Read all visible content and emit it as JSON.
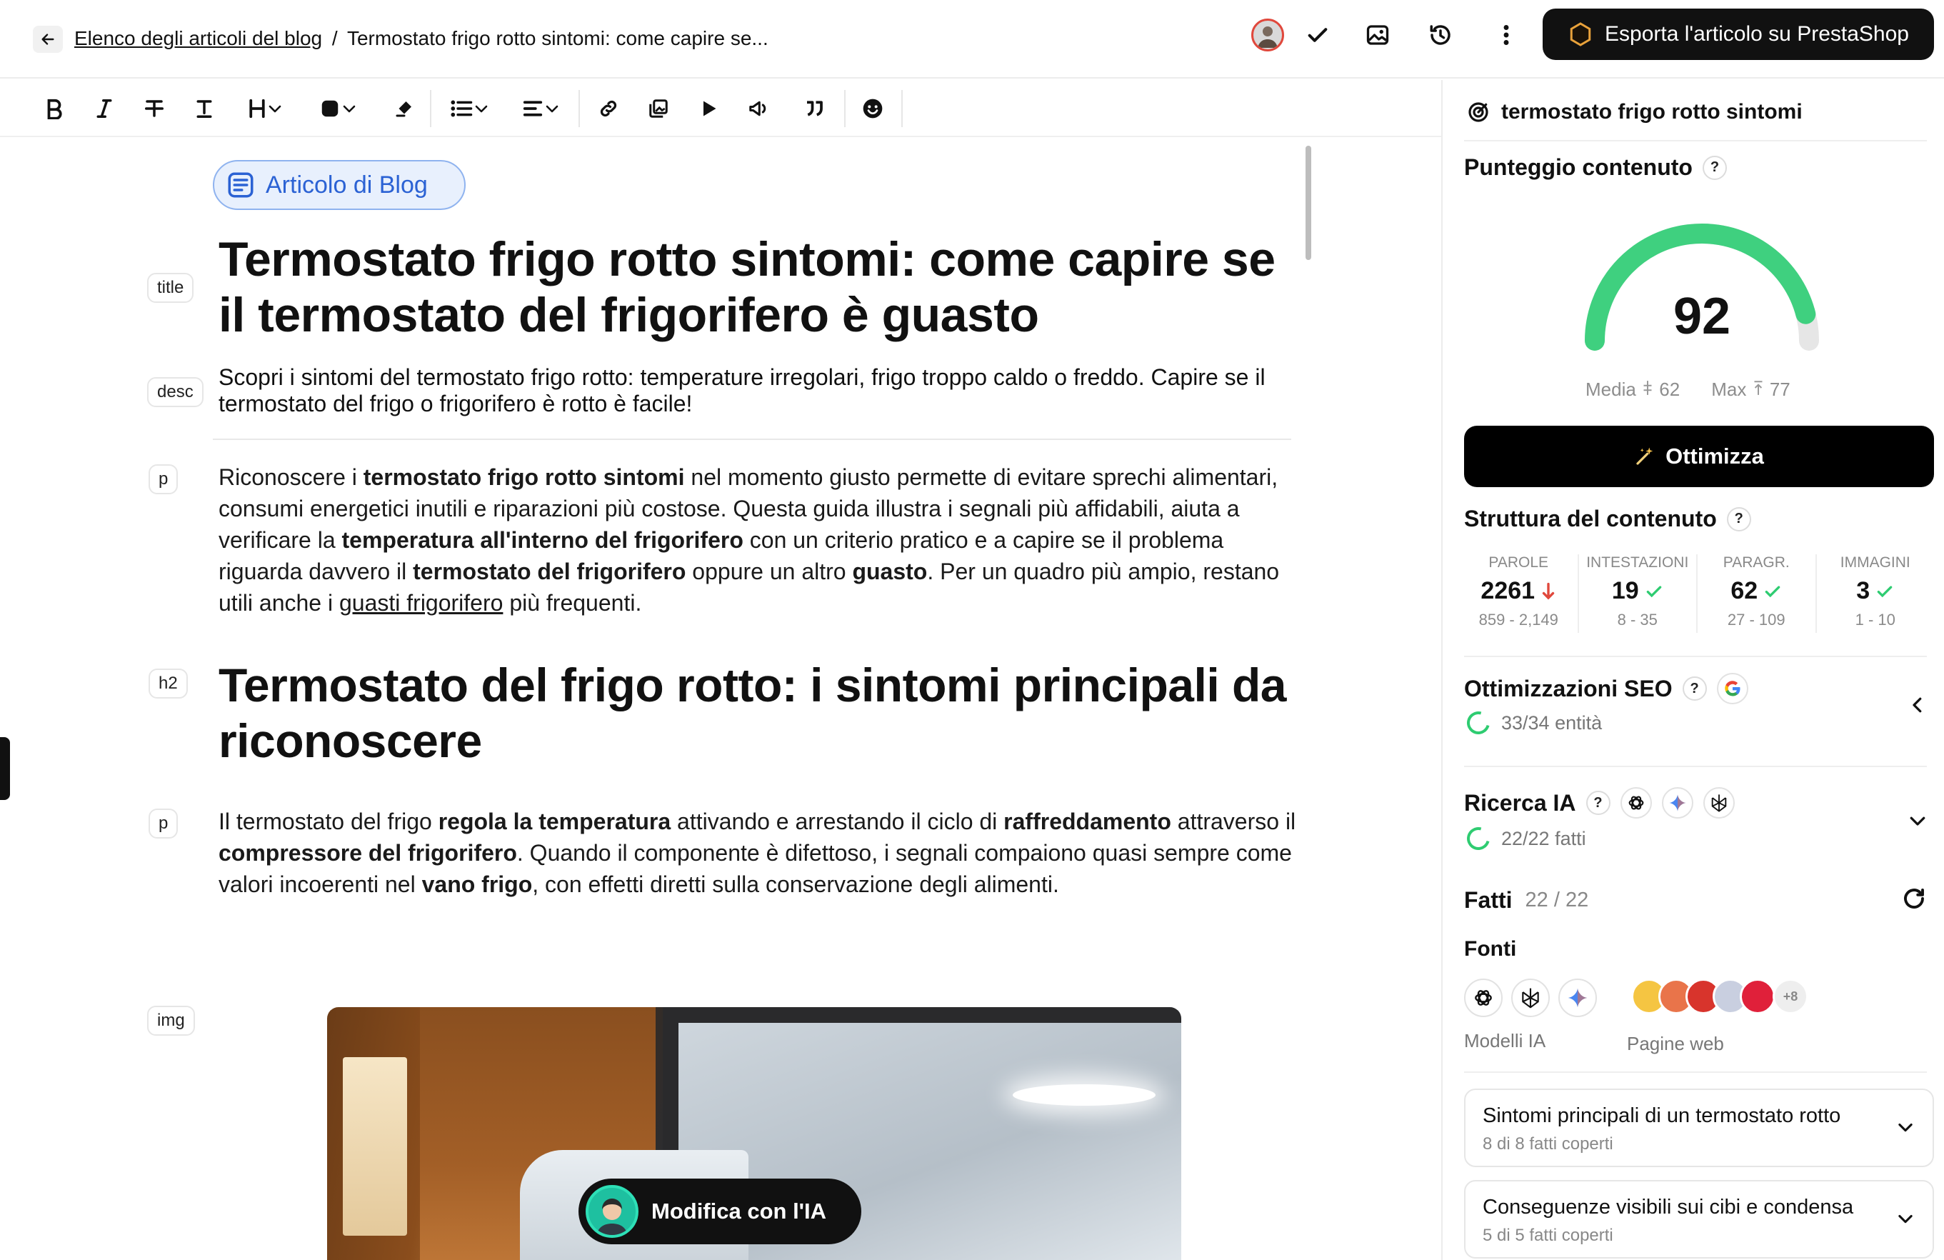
{
  "header": {
    "breadcrumb_link": "Elenco degli articoli del blog",
    "breadcrumb_sep": "/",
    "breadcrumb_current": "Termostato frigo rotto sintomi: come capire se...",
    "export_label": "Esporta l'articolo su PrestaShop"
  },
  "editor": {
    "type_chip": "Articolo di Blog",
    "labels": {
      "title": "title",
      "desc": "desc",
      "p": "p",
      "h2": "h2",
      "img": "img"
    },
    "title": "Termostato frigo rotto sintomi: come capire se il termostato del frigorifero è guasto",
    "description": "Scopri i sintomi del termostato frigo rotto: temperature irregolari, frigo troppo caldo o freddo. Capire se il termostato del frigo o frigorifero è rotto è facile!",
    "para1": [
      {
        "t": "Riconoscere i "
      },
      {
        "t": "termostato frigo rotto sintomi",
        "b": true
      },
      {
        "t": " nel momento giusto permette di evitare sprechi alimentari, consumi energetici inutili e riparazioni più costose. Questa guida illustra i segnali più affidabili, aiuta a verificare la "
      },
      {
        "t": "temperatura all'interno del frigorifero",
        "b": true
      },
      {
        "t": " con un criterio pratico e a capire se il problema riguarda davvero il "
      },
      {
        "t": "termostato del frigorifero",
        "b": true
      },
      {
        "t": " oppure un altro "
      },
      {
        "t": "guasto",
        "b": true
      },
      {
        "t": ". Per un quadro più ampio, restano utili anche i "
      },
      {
        "t": "guasti frigorifero",
        "u": true
      },
      {
        "t": " più frequenti."
      }
    ],
    "h2": "Termostato del frigo rotto: i sintomi principali da riconoscere",
    "para2": [
      {
        "t": "Il termostato del frigo "
      },
      {
        "t": "regola la temperatura",
        "b": true
      },
      {
        "t": " attivando e arrestando il ciclo di "
      },
      {
        "t": "raffreddamento",
        "b": true
      },
      {
        "t": " attraverso il "
      },
      {
        "t": "compressore del frigorifero",
        "b": true
      },
      {
        "t": ". Quando il componente è difettoso, i segnali compaiono quasi sempre come valori incoerenti nel "
      },
      {
        "t": "vano frigo",
        "b": true
      },
      {
        "t": ", con effetti diretti sulla conservazione degli alimenti."
      }
    ],
    "ai_edit_label": "Modifica con l'IA"
  },
  "panel": {
    "keyword": "termostato frigo rotto sintomi",
    "content_score_title": "Punteggio contenuto",
    "score": "92",
    "score_fraction": 0.92,
    "avg_label": "Media",
    "avg_value": "62",
    "max_label": "Max",
    "max_value": "77",
    "optimize_label": "Ottimizza",
    "structure_title": "Struttura del contenuto",
    "stats": [
      {
        "label": "PAROLE",
        "value": "2261",
        "status": "down",
        "range": "859 - 2,149"
      },
      {
        "label": "INTESTAZIONI",
        "value": "19",
        "status": "ok",
        "range": "8 - 35"
      },
      {
        "label": "PARAGR.",
        "value": "62",
        "status": "ok",
        "range": "27 - 109"
      },
      {
        "label": "IMMAGINI",
        "value": "3",
        "status": "ok",
        "range": "1 - 10"
      }
    ],
    "seo_title": "Ottimizzazioni SEO",
    "seo_sub": "33/34 entità",
    "ai_title": "Ricerca IA",
    "ai_sub": "22/22 fatti",
    "facts_title": "Fatti",
    "facts_count": "22 / 22",
    "sources_title": "Fonti",
    "ai_models_caption": "Modelli IA",
    "web_pages_caption": "Pagine web",
    "more_sources": "+8",
    "fact_cards": [
      {
        "title": "Sintomi principali di un termostato rotto",
        "sub": "8 di 8 fatti coperti"
      },
      {
        "title": "Conseguenze visibili sui cibi e condensa",
        "sub": "5 di 5 fatti coperti"
      }
    ]
  },
  "colors": {
    "accent_green": "#2ecc71",
    "gauge_green": "#3fd07f",
    "chip_blue": "#2b62d4",
    "danger_red": "#e0483c",
    "dark": "#111111"
  }
}
